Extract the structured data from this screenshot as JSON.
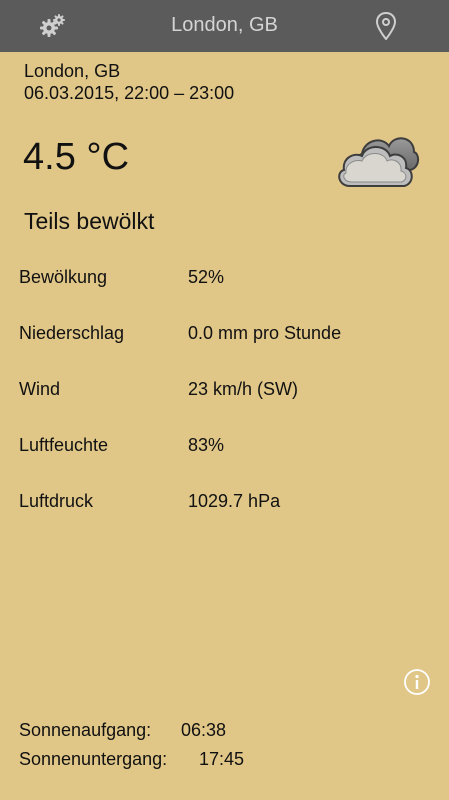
{
  "header": {
    "title": "London, GB",
    "left_icon": "gear-icon",
    "right_icon": "location-pin-icon"
  },
  "location": {
    "name": "London, GB",
    "datetime": "06.03.2015, 22:00 – 23:00"
  },
  "current": {
    "temperature": "4.5 °C",
    "condition": "Teils bewölkt",
    "icon": "cloud-icon"
  },
  "details": [
    {
      "label": "Bewölkung",
      "value": "52%"
    },
    {
      "label": "Niederschlag",
      "value": "0.0 mm pro Stunde"
    },
    {
      "label": "Wind",
      "value": "23 km/h (SW)"
    },
    {
      "label": "Luftfeuchte",
      "value": "83%"
    },
    {
      "label": "Luftdruck",
      "value": "1029.7 hPa"
    }
  ],
  "sun": {
    "sunrise_label": "Sonnenaufgang:",
    "sunrise": "06:38",
    "sunset_label": "Sonnenuntergang:",
    "sunset": "17:45"
  },
  "colors": {
    "background": "#e0c788",
    "header": "#5b5b5b",
    "header_text": "#d4d4d4"
  }
}
